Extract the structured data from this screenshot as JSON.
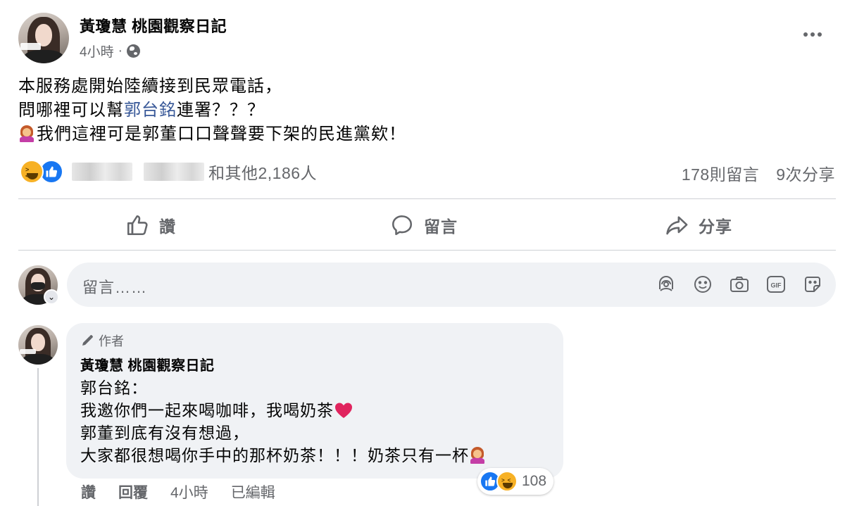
{
  "post": {
    "author": "黃瓊慧 桃園觀察日記",
    "time": "4小時",
    "dot": "·",
    "body": {
      "line1": "本服務處開始陸續接到民眾電話，",
      "line2_pre": "問哪裡可以幫",
      "line2_link": "郭台銘",
      "line2_post": "連署？？？",
      "line3": "我們這裡可是郭董口口聲聲要下架的民進黨欸！"
    },
    "reactions": {
      "icons": [
        "haha-icon",
        "like-icon"
      ],
      "others_label": "和其他2,186人"
    },
    "stats": {
      "comments": "178則留言",
      "shares": "9次分享"
    }
  },
  "actions": {
    "like": "讚",
    "comment": "留言",
    "share": "分享"
  },
  "comment_input": {
    "placeholder": "留言……",
    "icons": [
      "avatar-sticker-icon",
      "emoji-icon",
      "camera-icon",
      "gif-icon",
      "sticker-icon"
    ]
  },
  "comment": {
    "badge": "作者",
    "author": "黃瓊慧 桃園觀察日記",
    "lines": [
      "郭台銘：",
      "我邀你們一起來喝咖啡，我喝奶茶",
      "郭董到底有沒有想過，",
      "大家都很想喝你手中的那杯奶茶！！！奶茶只有一杯"
    ],
    "reaction_count": "108",
    "like": "讚",
    "reply": "回覆",
    "time": "4小時",
    "edited": "已編輯"
  },
  "colors": {
    "link": "#385898",
    "like_blue": "#1877f2",
    "haha_yellow": "#f7b125",
    "secondary_text": "#65676b",
    "bubble_bg": "#f0f2f5",
    "heart_red": "#e0245e"
  }
}
